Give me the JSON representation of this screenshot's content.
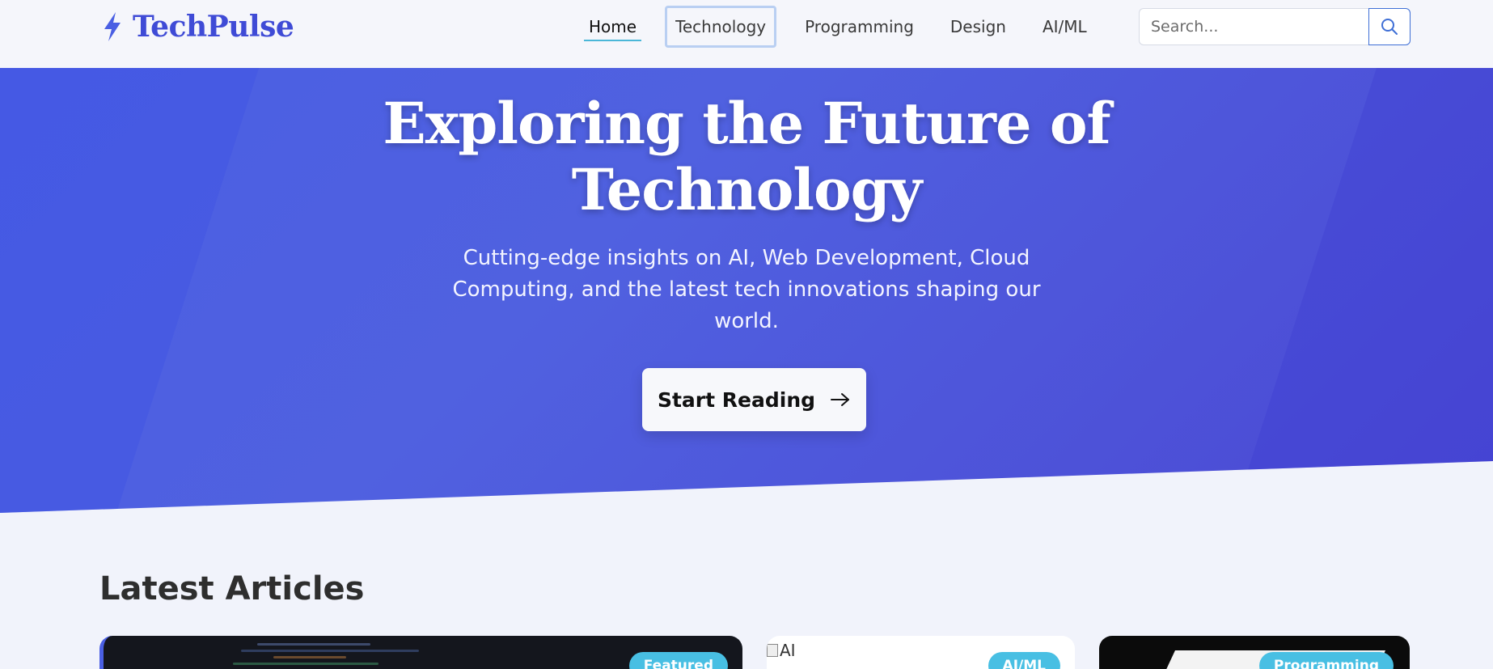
{
  "brand": {
    "name": "TechPulse",
    "icon": "lightning-bolt-icon",
    "color": "#3f4bd6"
  },
  "nav": {
    "items": [
      {
        "label": "Home",
        "state": "active"
      },
      {
        "label": "Technology",
        "state": "focused"
      },
      {
        "label": "Programming",
        "state": ""
      },
      {
        "label": "Design",
        "state": ""
      },
      {
        "label": "AI/ML",
        "state": ""
      }
    ],
    "search_placeholder": "Search...",
    "search_icon": "search-icon"
  },
  "hero": {
    "title": "Exploring the Future of Technology",
    "subtitle": "Cutting-edge insights on AI, Web Development, Cloud Computing, and the latest tech innovations shaping our world.",
    "cta_label": "Start Reading",
    "cta_icon": "arrow-right-icon",
    "gradient_start": "#4a5fe3",
    "gradient_end": "#4b48d3"
  },
  "latest": {
    "title": "Latest Articles",
    "cards": [
      {
        "badge": "Featured",
        "image_alt": ""
      },
      {
        "badge": "AI/ML",
        "image_alt": "AI"
      },
      {
        "badge": "Programming",
        "image_alt": ""
      }
    ],
    "badge_color": "#48bfe3"
  }
}
